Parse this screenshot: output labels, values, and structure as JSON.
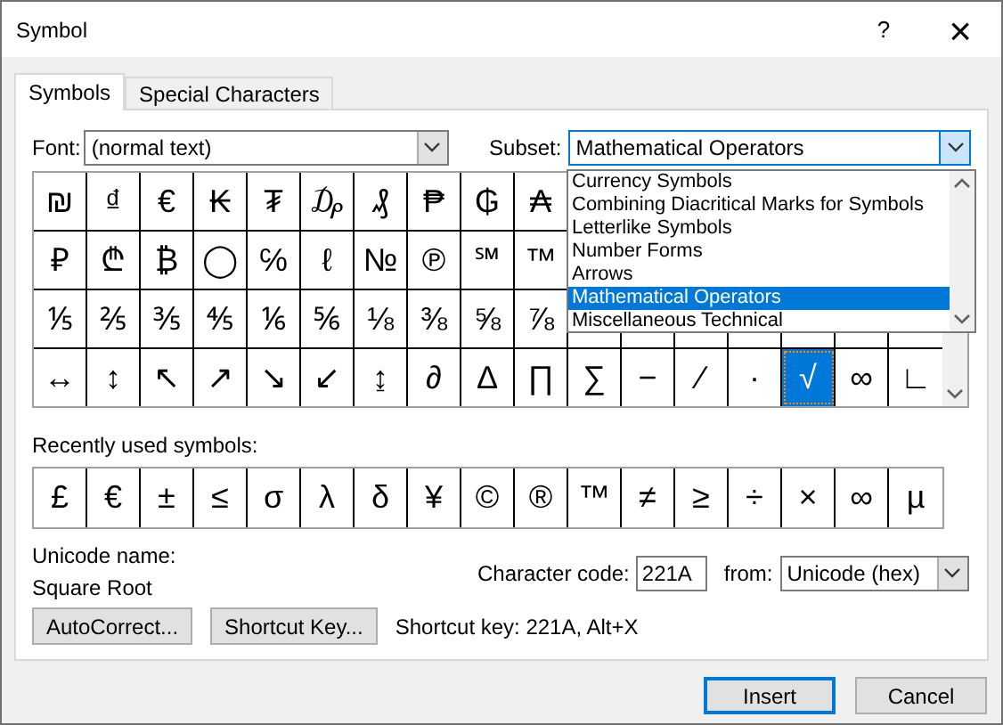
{
  "window": {
    "title": "Symbol",
    "help": "?",
    "close": "×"
  },
  "tabs": [
    {
      "label": "Symbols",
      "selected": true
    },
    {
      "label": "Special Characters",
      "selected": false
    }
  ],
  "font": {
    "label": "Font:",
    "value": "(normal text)"
  },
  "subset": {
    "label": "Subset:",
    "value": "Mathematical Operators",
    "expanded": true,
    "options": [
      {
        "label": "Currency Symbols",
        "selected": false
      },
      {
        "label": "Combining Diacritical Marks for Symbols",
        "selected": false
      },
      {
        "label": "Letterlike Symbols",
        "selected": false
      },
      {
        "label": "Number Forms",
        "selected": false
      },
      {
        "label": "Arrows",
        "selected": false
      },
      {
        "label": "Mathematical Operators",
        "selected": true
      },
      {
        "label": "Miscellaneous Technical",
        "selected": false
      }
    ]
  },
  "symbol_grid": [
    [
      {
        "char": "₪",
        "selected": false
      },
      {
        "char": "₫",
        "selected": false
      },
      {
        "char": "€",
        "selected": false
      },
      {
        "char": "₭",
        "selected": false
      },
      {
        "char": "₮",
        "selected": false
      },
      {
        "char": "₯",
        "selected": false
      },
      {
        "char": "₰",
        "selected": false
      },
      {
        "char": "₱",
        "selected": false
      },
      {
        "char": "₲",
        "selected": false
      },
      {
        "char": "₳",
        "selected": false
      }
    ],
    [
      {
        "char": "₽",
        "selected": false
      },
      {
        "char": "₾",
        "selected": false
      },
      {
        "char": "₿",
        "selected": false
      },
      {
        "char": "◯",
        "selected": false
      },
      {
        "char": "℅",
        "selected": false
      },
      {
        "char": "ℓ",
        "selected": false
      },
      {
        "char": "№",
        "selected": false
      },
      {
        "char": "℗",
        "selected": false
      },
      {
        "char": "℠",
        "selected": false
      },
      {
        "char": "™",
        "selected": false
      }
    ],
    [
      {
        "char": "⅕",
        "selected": false
      },
      {
        "char": "⅖",
        "selected": false
      },
      {
        "char": "⅗",
        "selected": false
      },
      {
        "char": "⅘",
        "selected": false
      },
      {
        "char": "⅙",
        "selected": false
      },
      {
        "char": "⅚",
        "selected": false
      },
      {
        "char": "⅛",
        "selected": false
      },
      {
        "char": "⅜",
        "selected": false
      },
      {
        "char": "⅝",
        "selected": false
      },
      {
        "char": "⅞",
        "selected": false
      }
    ],
    [
      {
        "char": "↔",
        "selected": false
      },
      {
        "char": "↕",
        "selected": false
      },
      {
        "char": "↖",
        "selected": false
      },
      {
        "char": "↗",
        "selected": false
      },
      {
        "char": "↘",
        "selected": false
      },
      {
        "char": "↙",
        "selected": false
      },
      {
        "char": "↨",
        "selected": false
      },
      {
        "char": "∂",
        "selected": false
      },
      {
        "char": "∆",
        "selected": false
      },
      {
        "char": "∏",
        "selected": false
      },
      {
        "char": "∑",
        "selected": false
      },
      {
        "char": "−",
        "selected": false
      },
      {
        "char": "∕",
        "selected": false
      },
      {
        "char": "∙",
        "selected": false
      },
      {
        "char": "√",
        "selected": true
      },
      {
        "char": "∞",
        "selected": false
      },
      {
        "char": "∟",
        "selected": false
      }
    ]
  ],
  "recent": {
    "label": "Recently used symbols:",
    "symbols": [
      "£",
      "€",
      "±",
      "≤",
      "σ",
      "λ",
      "δ",
      "¥",
      "©",
      "®",
      "™",
      "≠",
      "≥",
      "÷",
      "×",
      "∞",
      "µ"
    ]
  },
  "unicode_name": {
    "label": "Unicode name:",
    "value": "Square Root"
  },
  "character_code": {
    "label": "Character code:",
    "value": "221A"
  },
  "from": {
    "label": "from:",
    "value": "Unicode (hex)"
  },
  "buttons": [
    "AutoCorrect...",
    "Shortcut Key..."
  ],
  "shortcut_text": "Shortcut key: 221A, Alt+X",
  "footer_buttons": [
    {
      "label": "Insert",
      "default": true
    },
    {
      "label": "Cancel",
      "default": false
    }
  ]
}
